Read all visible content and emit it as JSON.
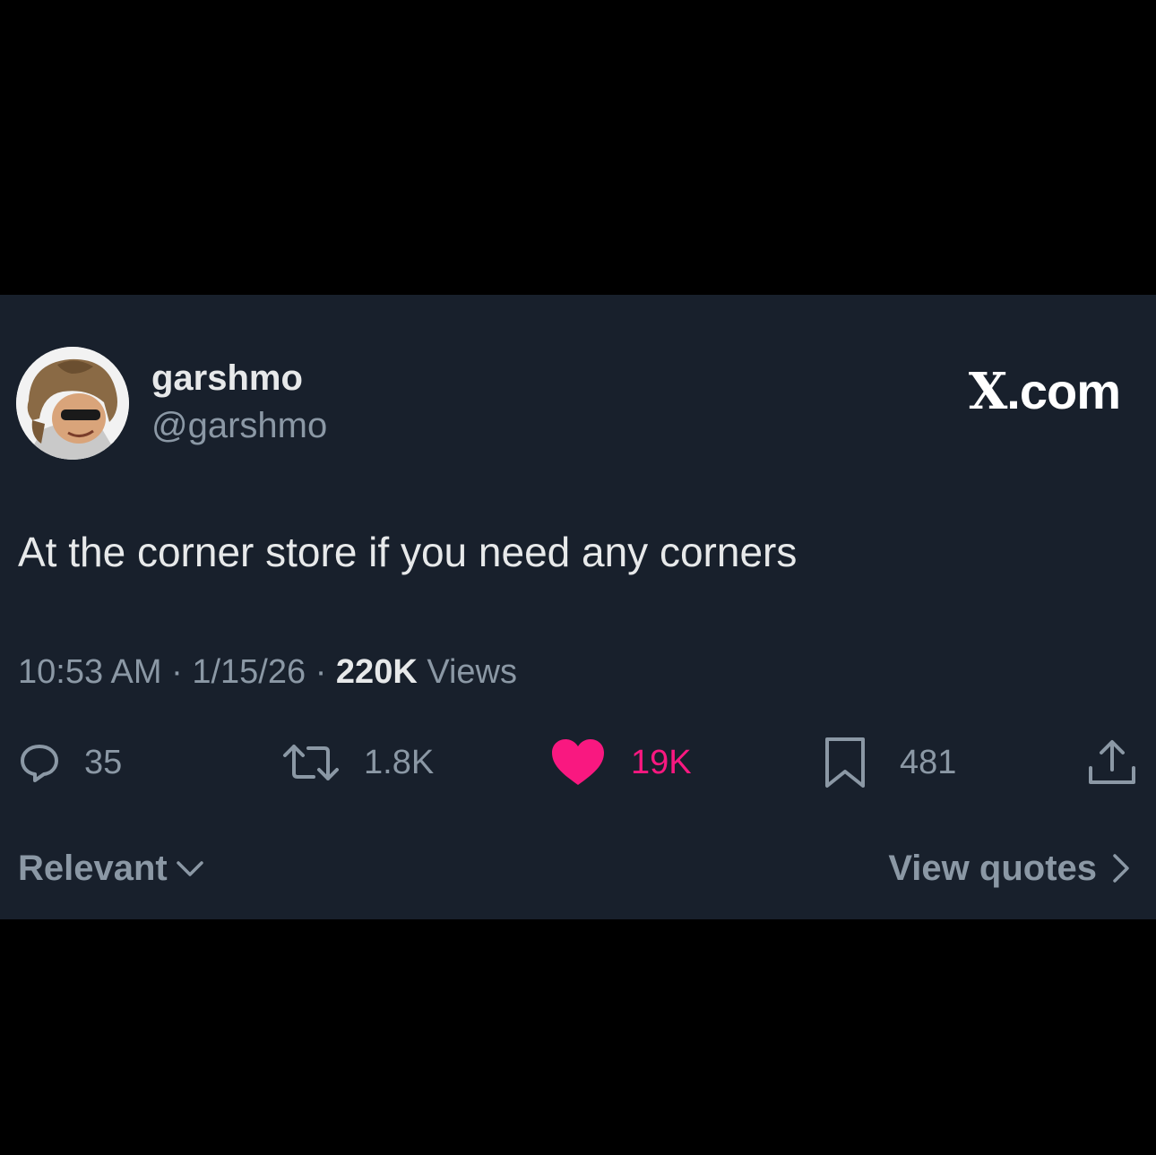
{
  "author": {
    "display_name": "garshmo",
    "handle": "@garshmo",
    "avatar_icon": "profile-photo"
  },
  "brand": {
    "x_letter": "X",
    "suffix": ".com"
  },
  "tweet": {
    "text": "At the corner store if you need any corners"
  },
  "meta": {
    "time": "10:53 AM",
    "separator1": " · ",
    "date": "1/15/26",
    "separator2": " · ",
    "views_count": "220K",
    "views_label": " Views"
  },
  "actions": {
    "replies": "35",
    "reposts": "1.8K",
    "likes": "19K",
    "bookmarks": "481",
    "like_color": "#f91880"
  },
  "footer": {
    "sort_label": "Relevant",
    "quotes_label": "View quotes"
  },
  "colors": {
    "background": "#000000",
    "card": "#18202c",
    "primary_text": "#e7e9ea",
    "secondary_text": "#8b98a5"
  }
}
